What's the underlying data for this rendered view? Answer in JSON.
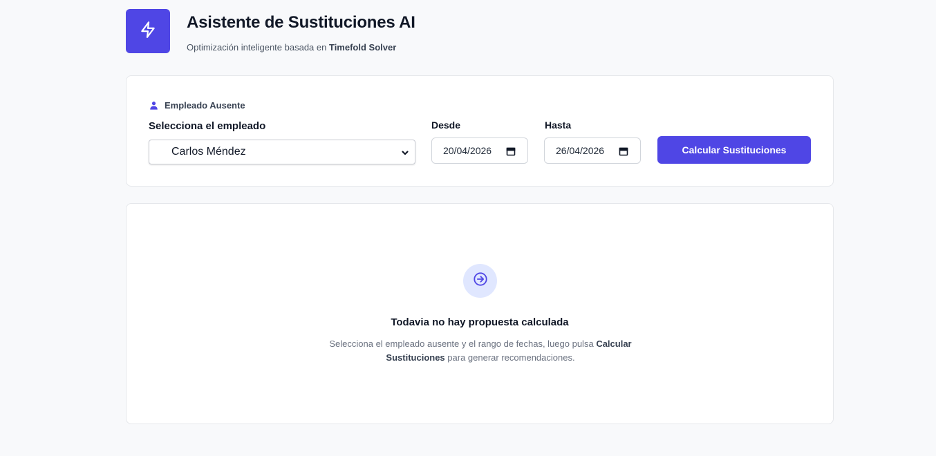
{
  "header": {
    "title": "Asistente de Sustituciones AI",
    "subtitle_prefix": "Optimización inteligente basada en",
    "subtitle_emphasis": "Timefold Solver",
    "logo_icon": "lightning-bolt-icon"
  },
  "form": {
    "section_label": "Empleado Ausente",
    "section_icon": "user-icon",
    "employee_label": "Selecciona el empleado",
    "employee_selected": "Carlos Méndez",
    "desde_label": "Desde",
    "desde_value": "20/04/2026",
    "hasta_label": "Hasta",
    "hasta_value": "26/04/2026",
    "submit_label": "Calcular Sustituciones"
  },
  "empty_state": {
    "icon": "arrow-right-circle-icon",
    "title": "Todavia no hay propuesta calculada",
    "desc_part1": "Selecciona el empleado ausente y el rango de fechas, luego pulsa",
    "desc_bold1": "Calcular",
    "desc_bold2": "Sustituciones",
    "desc_part2": "para generar recomendaciones."
  },
  "colors": {
    "accent": "#4f46e5",
    "accent_light": "#e0e7ff",
    "background": "#f8f9fb",
    "card": "#ffffff",
    "border": "#e5e7eb"
  }
}
